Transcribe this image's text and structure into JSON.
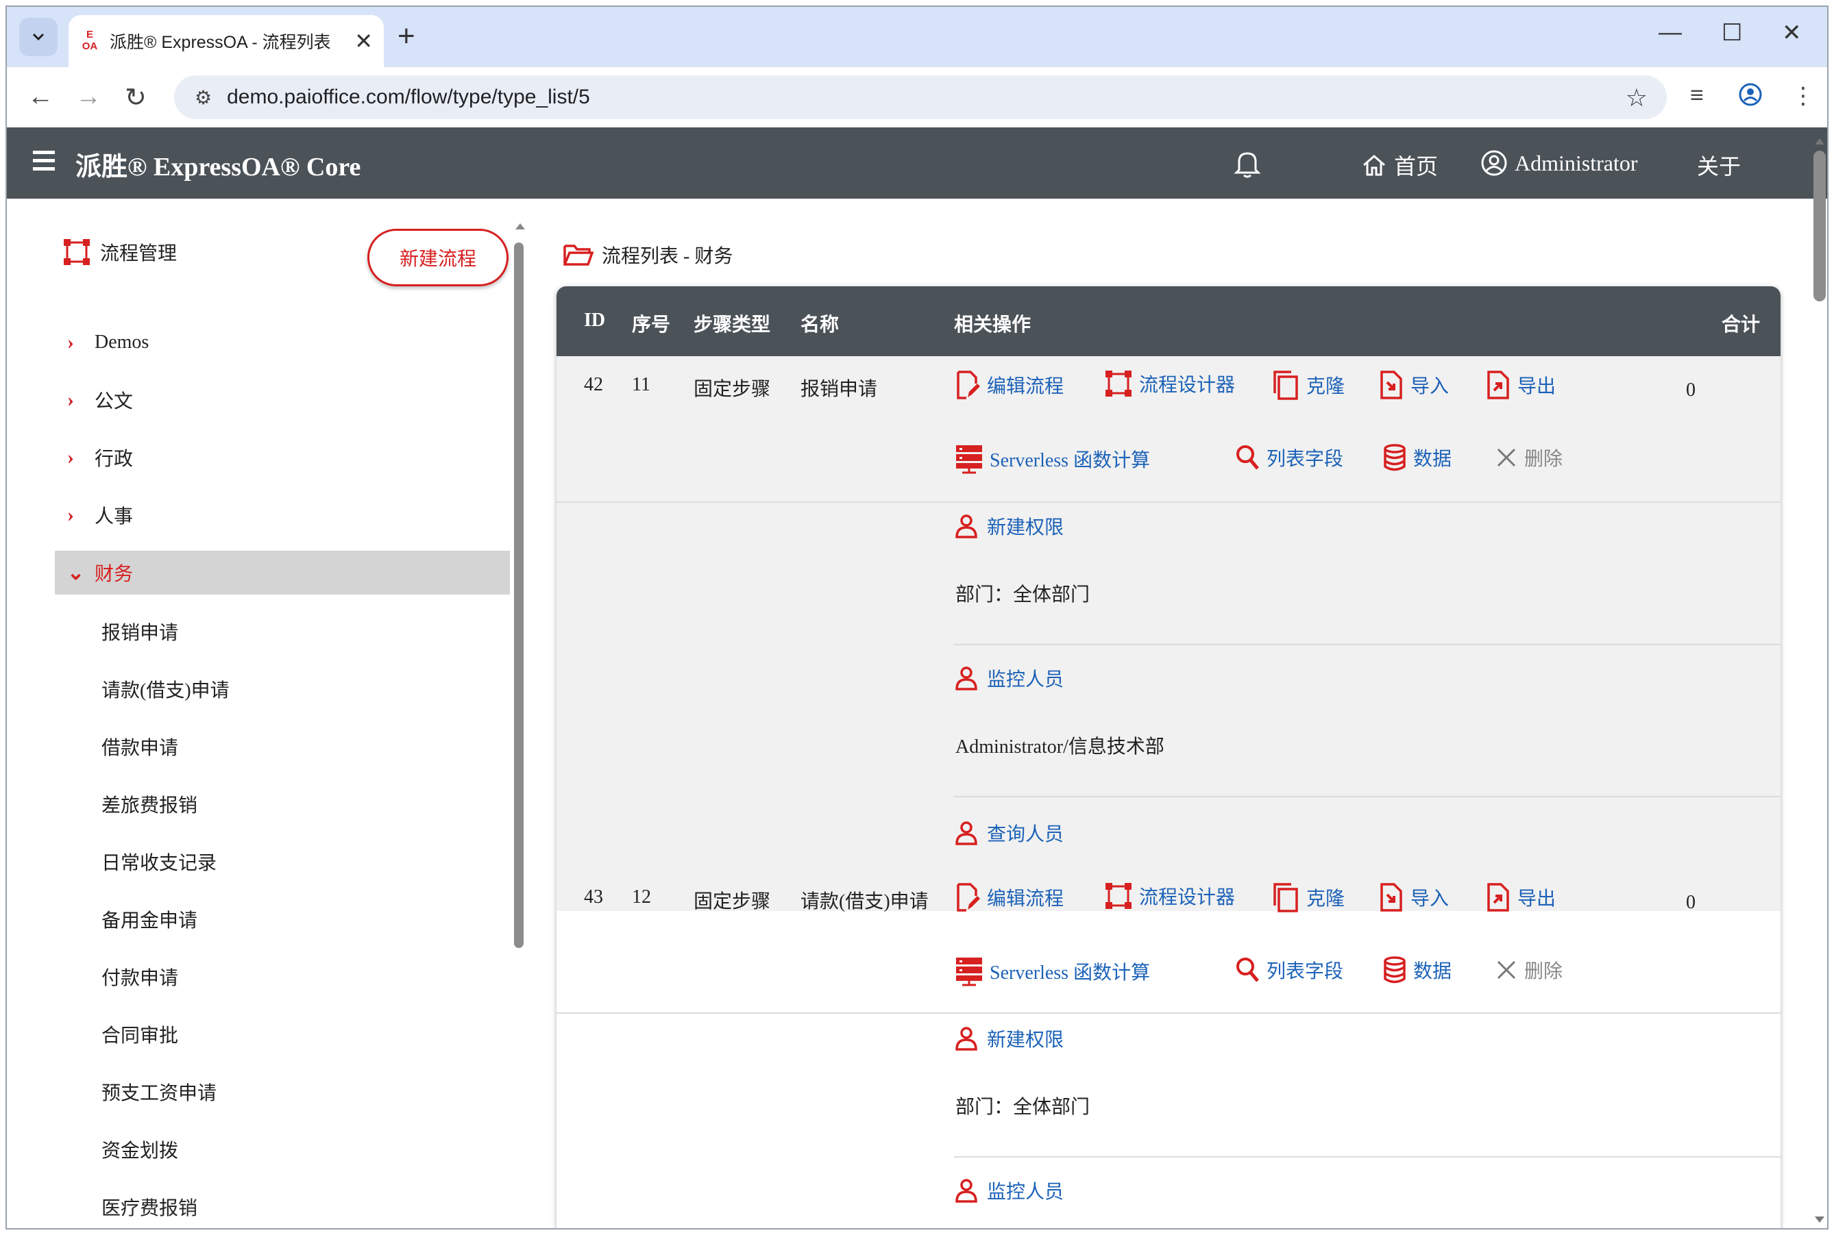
{
  "browser": {
    "tab_title": "派胜® ExpressOA - 流程列表",
    "tab_favicon_top": "E",
    "tab_favicon_bottom": "OA",
    "new_tab": "+",
    "url": "demo.paioffice.com/flow/type/type_list/5"
  },
  "app": {
    "brand": "派胜® ExpressOA® Core",
    "nav": {
      "home": "首页",
      "user": "Administrator",
      "about": "关于"
    }
  },
  "sidebar": {
    "title": "流程管理",
    "new_button": "新建流程",
    "categories": [
      "Demos",
      "公文",
      "行政",
      "人事",
      "财务"
    ],
    "active_category": "财务",
    "sub_items": [
      "报销申请",
      "请款(借支)申请",
      "借款申请",
      "差旅费报销",
      "日常收支记录",
      "备用金申请",
      "付款申请",
      "合同审批",
      "预支工资申请",
      "资金划拨",
      "医疗费报销"
    ]
  },
  "main": {
    "breadcrumb": "流程列表 - 财务",
    "columns": {
      "id": "ID",
      "seq": "序号",
      "step_type": "步骤类型",
      "name": "名称",
      "actions": "相关操作",
      "total": "合计"
    },
    "actions": {
      "edit": "编辑流程",
      "designer": "流程设计器",
      "clone": "克隆",
      "import": "导入",
      "export": "导出",
      "serverless": "Serverless 函数计算",
      "list_fields": "列表字段",
      "data": "数据",
      "delete": "删除"
    },
    "permissions": {
      "new_perm": "新建权限",
      "monitor": "监控人员",
      "query": "查询人员"
    },
    "rows": [
      {
        "id": "42",
        "seq": "11",
        "step_type": "固定步骤",
        "name": "报销申请",
        "total": "0",
        "new_perm_value": "部门：全体部门",
        "monitor_value": "Administrator/信息技术部"
      },
      {
        "id": "43",
        "seq": "12",
        "step_type": "固定步骤",
        "name": "请款(借支)申请",
        "total": "0",
        "new_perm_value": "部门：全体部门"
      }
    ]
  },
  "colors": {
    "accent": "#d72020",
    "link": "#1c62b8",
    "header_bg": "#4b5258",
    "chrome_bg": "#d6e3f8"
  }
}
